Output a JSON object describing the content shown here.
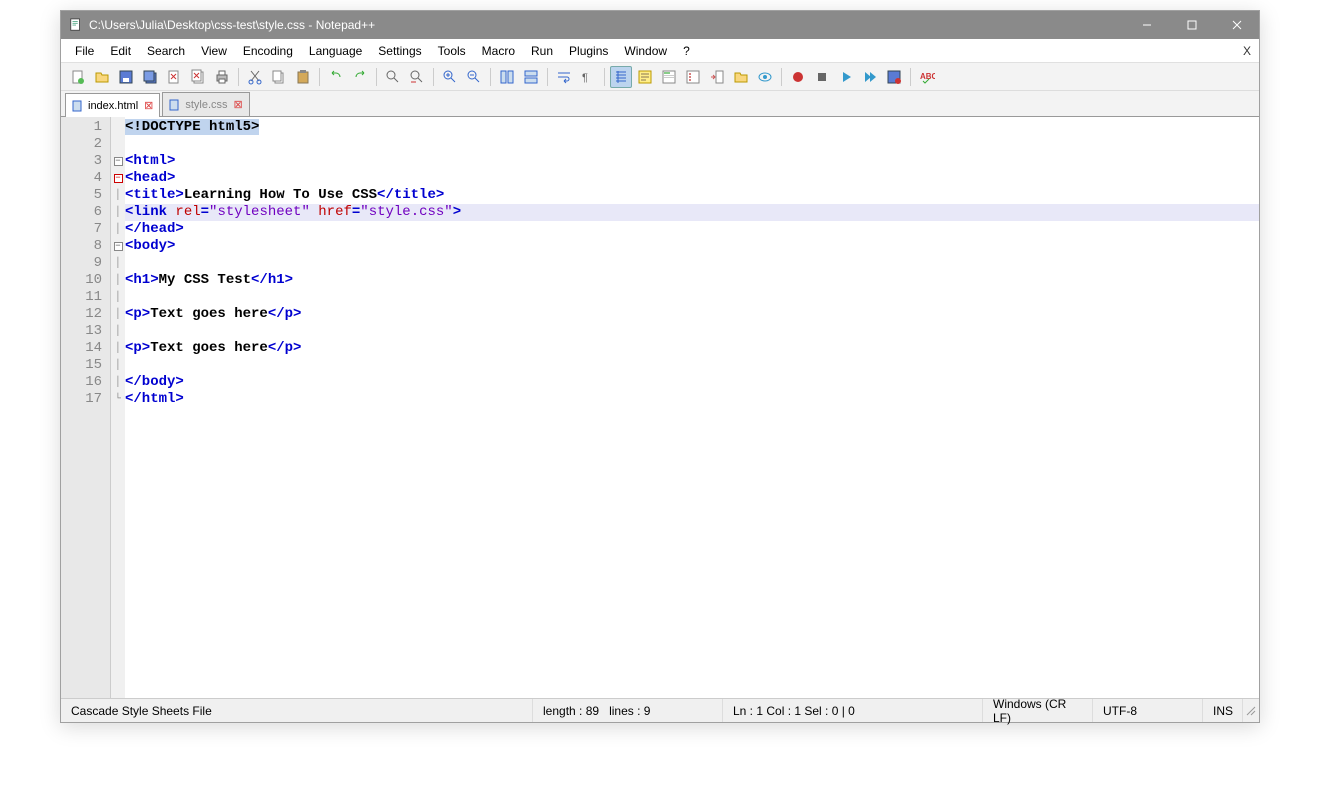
{
  "titlebar": {
    "path": "C:\\Users\\Julia\\Desktop\\css-test\\style.css - Notepad++"
  },
  "menus": [
    "File",
    "Edit",
    "Search",
    "View",
    "Encoding",
    "Language",
    "Settings",
    "Tools",
    "Macro",
    "Run",
    "Plugins",
    "Window",
    "?"
  ],
  "tabs": [
    {
      "label": "index.html",
      "active": true
    },
    {
      "label": "style.css",
      "active": false
    }
  ],
  "editor": {
    "line_count": 17,
    "highlighted_line": 6,
    "code_lines": [
      {
        "n": 1,
        "fold": "",
        "tokens": [
          {
            "t": "sel",
            "v": "<!DOCTYPE html5>"
          }
        ]
      },
      {
        "n": 2,
        "fold": "",
        "tokens": []
      },
      {
        "n": 3,
        "fold": "minus",
        "tokens": [
          {
            "t": "tag",
            "v": "<html>"
          }
        ]
      },
      {
        "n": 4,
        "fold": "minus-red",
        "tokens": [
          {
            "t": "tag",
            "v": "<head>"
          }
        ]
      },
      {
        "n": 5,
        "fold": "line",
        "tokens": [
          {
            "t": "tag",
            "v": "<title>"
          },
          {
            "t": "text",
            "v": "Learning How To Use CSS"
          },
          {
            "t": "tag",
            "v": "</title>"
          }
        ]
      },
      {
        "n": 6,
        "fold": "line",
        "tokens": [
          {
            "t": "tag",
            "v": "<link "
          },
          {
            "t": "attr",
            "v": "rel"
          },
          {
            "t": "tag",
            "v": "="
          },
          {
            "t": "val",
            "v": "\"stylesheet\""
          },
          {
            "t": "tag",
            "v": " "
          },
          {
            "t": "attr",
            "v": "href"
          },
          {
            "t": "tag",
            "v": "="
          },
          {
            "t": "val",
            "v": "\"style.css\""
          },
          {
            "t": "tag",
            "v": ">"
          }
        ]
      },
      {
        "n": 7,
        "fold": "line",
        "tokens": [
          {
            "t": "tag",
            "v": "</head>"
          }
        ]
      },
      {
        "n": 8,
        "fold": "minus",
        "tokens": [
          {
            "t": "tag",
            "v": "<body>"
          }
        ]
      },
      {
        "n": 9,
        "fold": "line",
        "tokens": []
      },
      {
        "n": 10,
        "fold": "line",
        "tokens": [
          {
            "t": "tag",
            "v": "<h1>"
          },
          {
            "t": "text",
            "v": "My CSS Test"
          },
          {
            "t": "tag",
            "v": "</h1>"
          }
        ]
      },
      {
        "n": 11,
        "fold": "line",
        "tokens": []
      },
      {
        "n": 12,
        "fold": "line",
        "tokens": [
          {
            "t": "tag",
            "v": "<p>"
          },
          {
            "t": "text",
            "v": "Text goes here"
          },
          {
            "t": "tag",
            "v": "</p>"
          }
        ]
      },
      {
        "n": 13,
        "fold": "line",
        "tokens": []
      },
      {
        "n": 14,
        "fold": "line",
        "tokens": [
          {
            "t": "tag",
            "v": "<p>"
          },
          {
            "t": "text",
            "v": "Text goes here"
          },
          {
            "t": "tag",
            "v": "</p>"
          }
        ]
      },
      {
        "n": 15,
        "fold": "line",
        "tokens": []
      },
      {
        "n": 16,
        "fold": "line",
        "tokens": [
          {
            "t": "tag",
            "v": "</body>"
          }
        ]
      },
      {
        "n": 17,
        "fold": "end",
        "tokens": [
          {
            "t": "tag",
            "v": "</html>"
          }
        ]
      }
    ]
  },
  "statusbar": {
    "file_type": "Cascade Style Sheets File",
    "length": "length : 89",
    "lines": "lines : 9",
    "pos": "Ln : 1   Col : 1   Sel : 0 | 0",
    "eol": "Windows (CR LF)",
    "encoding": "UTF-8",
    "mode": "INS"
  }
}
